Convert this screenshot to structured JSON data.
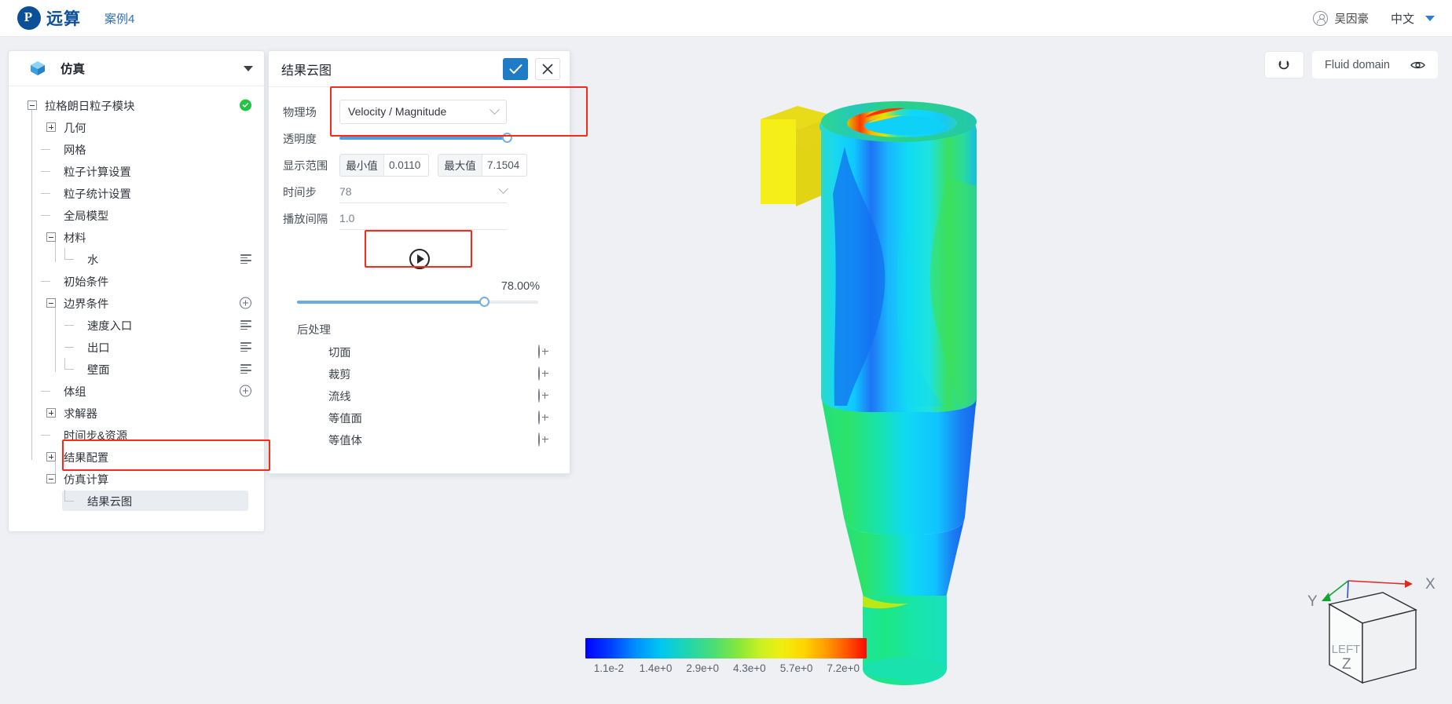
{
  "header": {
    "brand_mark": "P",
    "brand_name": "远算",
    "case_name": "案例4",
    "user_name": "吴因豪",
    "language": "中文",
    "avatar_icon": "user-circle-icon",
    "caret_icon": "caret-down-icon"
  },
  "tree_panel": {
    "icon": "cube-icon",
    "title": "仿真",
    "collapse_icon": "caret-down-icon",
    "items": [
      {
        "label": "拉格朗日粒子模块",
        "depth": 0,
        "toggle": "minus",
        "badge": "check-circle-icon"
      },
      {
        "label": "几何",
        "depth": 1,
        "toggle": "plus"
      },
      {
        "label": "网格",
        "depth": 1,
        "toggle": "stub"
      },
      {
        "label": "粒子计算设置",
        "depth": 1,
        "toggle": "stub"
      },
      {
        "label": "粒子统计设置",
        "depth": 1,
        "toggle": "stub"
      },
      {
        "label": "全局模型",
        "depth": 1,
        "toggle": "stub"
      },
      {
        "label": "材料",
        "depth": 1,
        "toggle": "minus"
      },
      {
        "label": "水",
        "depth": 2,
        "toggle": "stub-last",
        "action": "list-icon"
      },
      {
        "label": "初始条件",
        "depth": 1,
        "toggle": "stub"
      },
      {
        "label": "边界条件",
        "depth": 1,
        "toggle": "minus",
        "action": "plus-circle-icon"
      },
      {
        "label": "速度入口",
        "depth": 2,
        "toggle": "stub",
        "action": "list-icon"
      },
      {
        "label": "出口",
        "depth": 2,
        "toggle": "stub",
        "action": "list-icon"
      },
      {
        "label": "壁面",
        "depth": 2,
        "toggle": "stub-last",
        "action": "list-icon"
      },
      {
        "label": "体组",
        "depth": 1,
        "toggle": "stub",
        "action": "plus-circle-icon"
      },
      {
        "label": "求解器",
        "depth": 1,
        "toggle": "plus"
      },
      {
        "label": "时间步&资源",
        "depth": 1,
        "toggle": "stub"
      },
      {
        "label": "结果配置",
        "depth": 1,
        "toggle": "plus"
      },
      {
        "label": "仿真计算",
        "depth": 1,
        "toggle": "minus"
      },
      {
        "label": "结果云图",
        "depth": 2,
        "toggle": "stub-last",
        "selected": true
      }
    ]
  },
  "result_panel": {
    "title": "结果云图",
    "confirm_icon": "check-icon",
    "close_icon": "close-icon",
    "field_label": "物理场",
    "field_value": "Velocity / Magnitude",
    "field_chevron": "chevron-down-icon",
    "opacity_label": "透明度",
    "opacity_value": "100",
    "range_label": "显示范围",
    "min_tag": "最小值",
    "min_value": "0.0110",
    "max_tag": "最大值",
    "max_value": "7.1504",
    "timestep_label": "时间步",
    "timestep_value": "78",
    "timestep_chevron": "chevron-down-icon",
    "interval_label": "播放间隔",
    "interval_value": "1.0",
    "play_icon": "play-circle-icon",
    "progress_percent": "78.00%",
    "progress_value": 78,
    "post_title": "后处理",
    "post_items": [
      {
        "label": "切面",
        "add_icon": "plus-circle-icon"
      },
      {
        "label": "裁剪",
        "add_icon": "plus-circle-icon"
      },
      {
        "label": "流线",
        "add_icon": "plus-circle-icon"
      },
      {
        "label": "等值面",
        "add_icon": "plus-circle-icon"
      },
      {
        "label": "等值体",
        "add_icon": "plus-circle-icon"
      }
    ]
  },
  "viewport_toolbar": {
    "reset_icon": "rotate-reset-icon",
    "domain_label": "Fluid domain",
    "visibility_icon": "eye-icon"
  },
  "colorbar": {
    "ticks": [
      "1.1e-2",
      "1.4e+0",
      "2.9e+0",
      "4.3e+0",
      "5.7e+0",
      "7.2e+0"
    ]
  },
  "gizmo": {
    "axis_x": "X",
    "axis_y": "Y",
    "axis_z": "Z",
    "face_label": "LEFT",
    "color_x": "#e02b20",
    "color_y": "#12a437",
    "color_z": "#2a4fd6"
  },
  "highlights": {
    "field_row": "red-highlight-box",
    "play_button": "red-highlight-box",
    "tree_selection": "red-highlight-box"
  }
}
